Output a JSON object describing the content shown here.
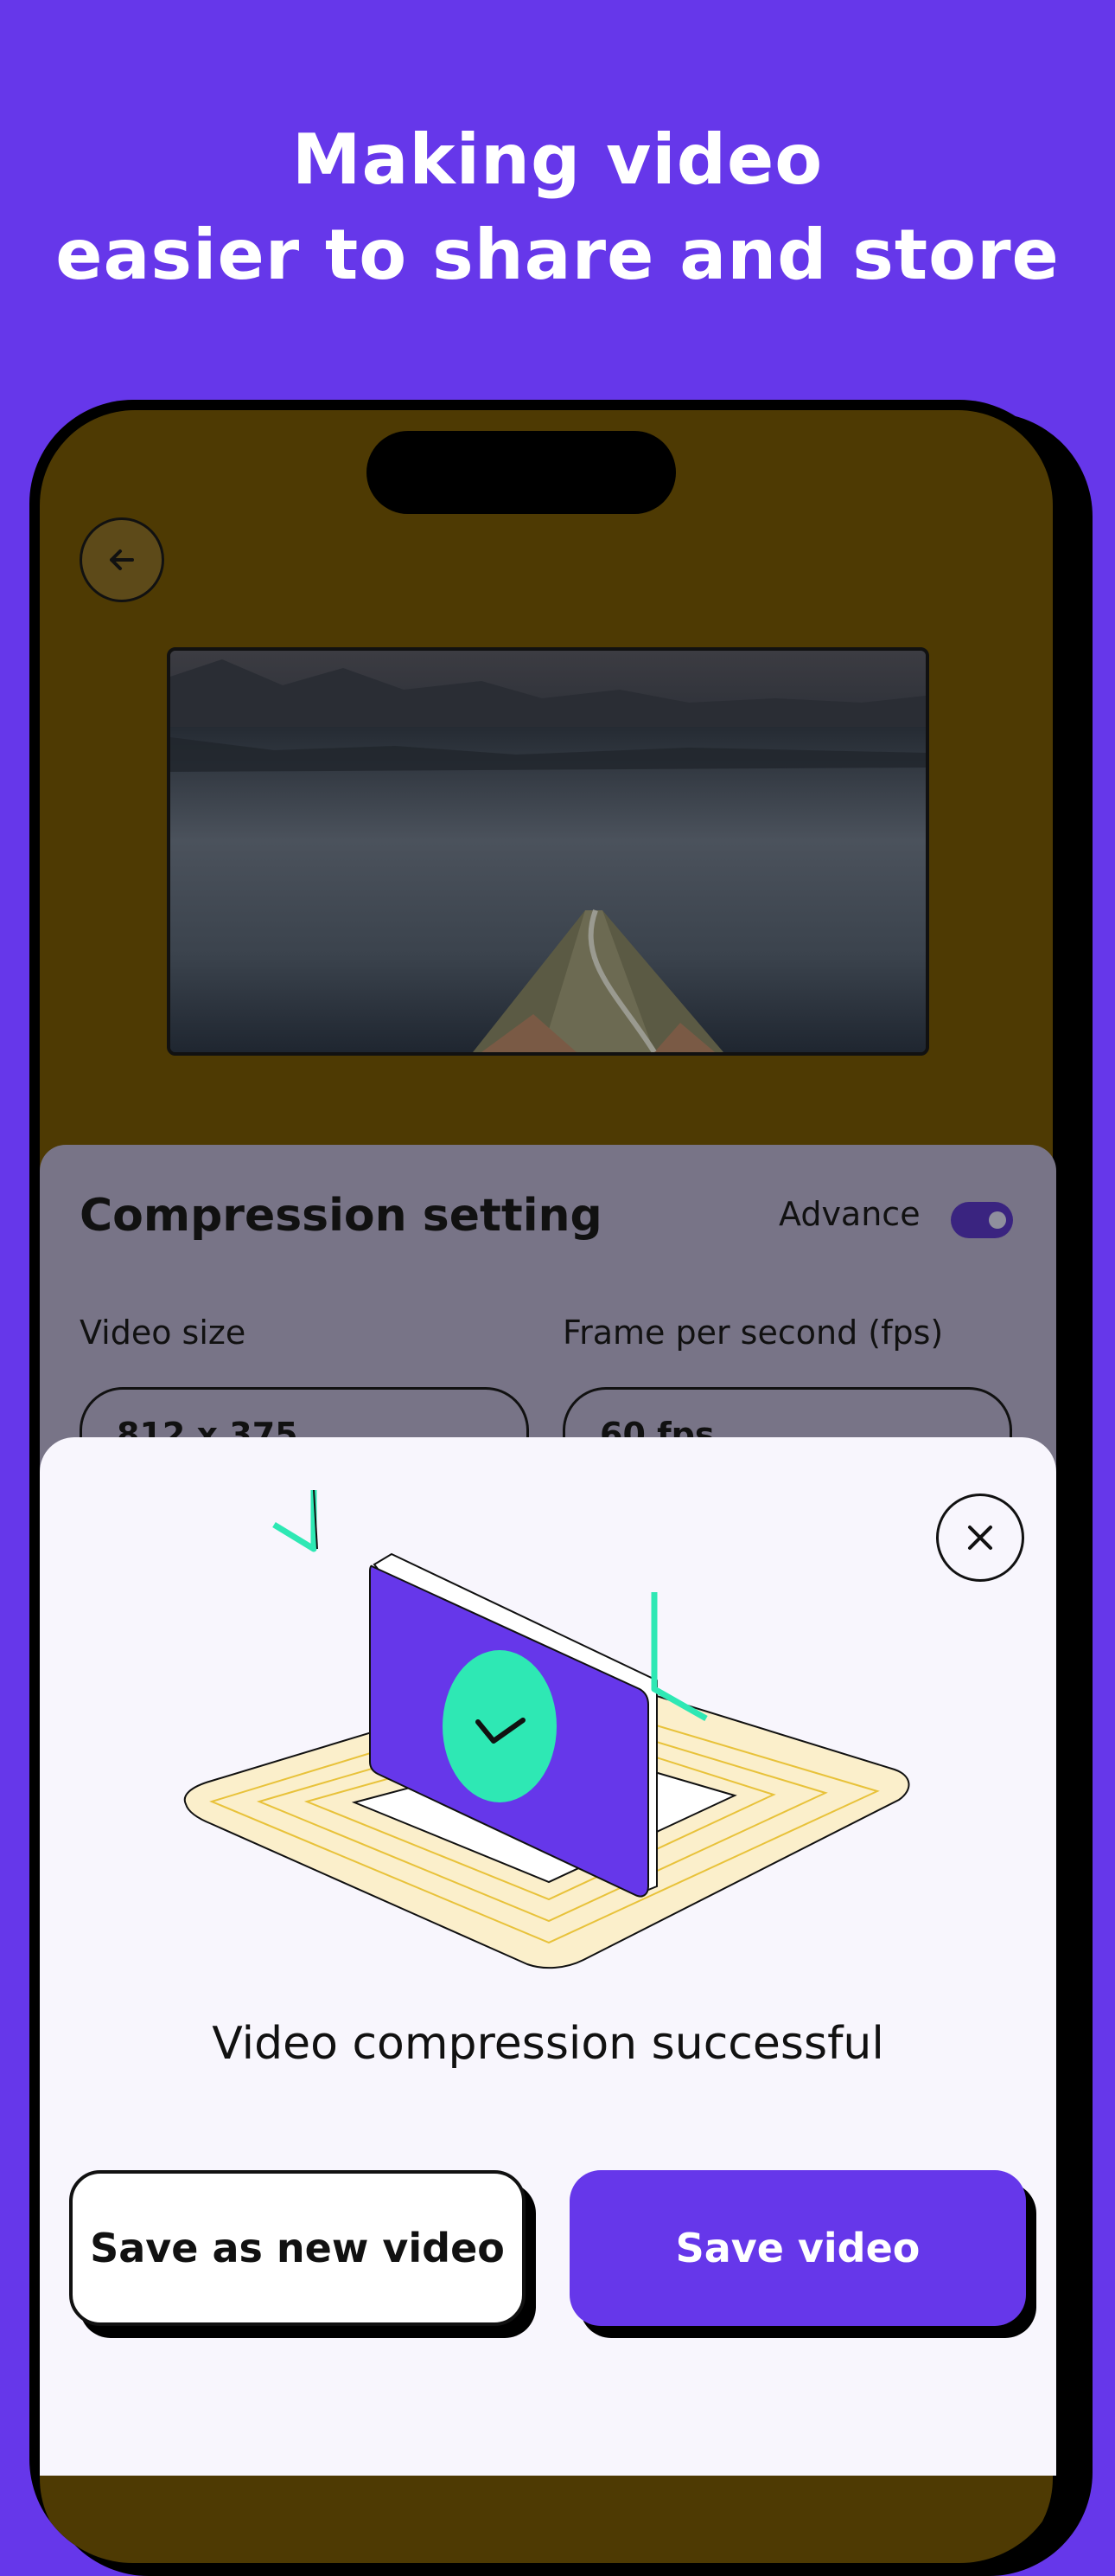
{
  "headline": {
    "line1": "Making video",
    "line2": "easier to share and store"
  },
  "icons": {
    "back": "arrow-left-icon",
    "close": "close-icon",
    "check": "checkmark-icon"
  },
  "colors": {
    "brand": "#6637EA",
    "accent_green": "#2EE8B4",
    "sheet_bg": "#F8F6FD",
    "platform_cream": "#FBEFCB",
    "platform_line": "#E8C23A"
  },
  "settings": {
    "title": "Compression setting",
    "advance_label": "Advance",
    "advance_on": true,
    "video_size_label": "Video size",
    "video_size_value": "812 x 375",
    "fps_label": "Frame per second (fps)",
    "fps_value": "60 fps"
  },
  "dialog": {
    "message": "Video compression successful",
    "secondary_button": "Save as new video",
    "primary_button": "Save video"
  }
}
